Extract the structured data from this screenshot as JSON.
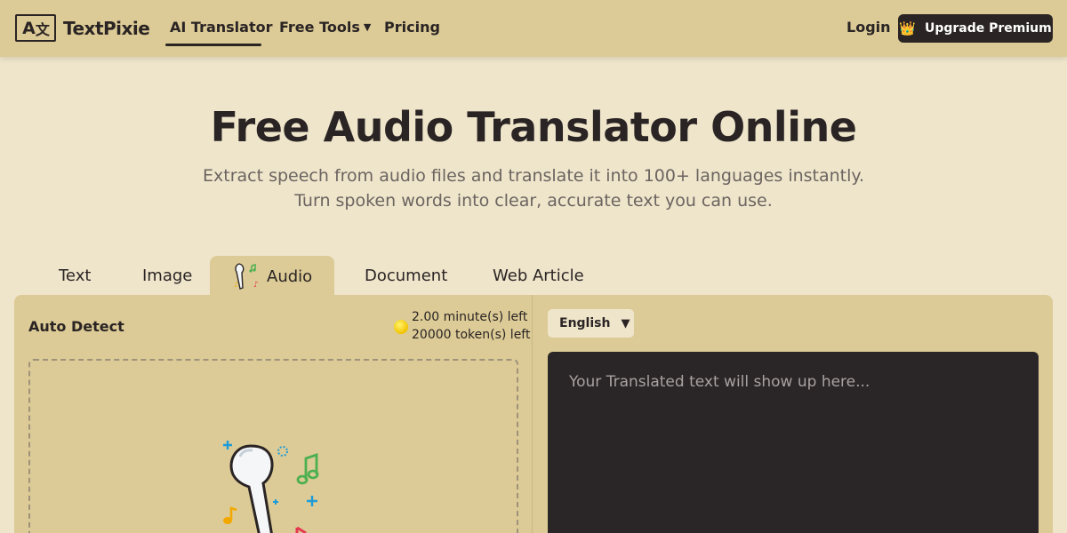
{
  "header": {
    "logo_mark_left": "A",
    "logo_mark_right": "文",
    "logo_text": "TextPixie",
    "nav": {
      "ai_translator": "AI Translator",
      "free_tools": "Free Tools",
      "pricing": "Pricing"
    },
    "login": "Login",
    "upgrade": "Upgrade Premium"
  },
  "hero": {
    "title": "Free Audio Translator Online",
    "subtitle": "Extract speech from audio files and translate it into 100+ languages instantly. Turn spoken words into clear, accurate text you can use."
  },
  "tabs": {
    "text": "Text",
    "image": "Image",
    "audio": "Audio",
    "document": "Document",
    "web_article": "Web Article",
    "active": "audio"
  },
  "source": {
    "language": "Auto Detect",
    "minutes_left": "2.00 minute(s) left",
    "tokens_left": "20000 token(s) left"
  },
  "target": {
    "language": "English",
    "placeholder": "Your Translated text will show up here..."
  },
  "icons": {
    "crown": "crown-icon",
    "caret": "caret-down-icon",
    "coin": "coin-icon",
    "earbud": "earbud-icon"
  },
  "colors": {
    "header_bg": "#dccb96",
    "page_bg": "#efe5cb",
    "dark": "#2a2424",
    "coin": "#f2c300"
  }
}
